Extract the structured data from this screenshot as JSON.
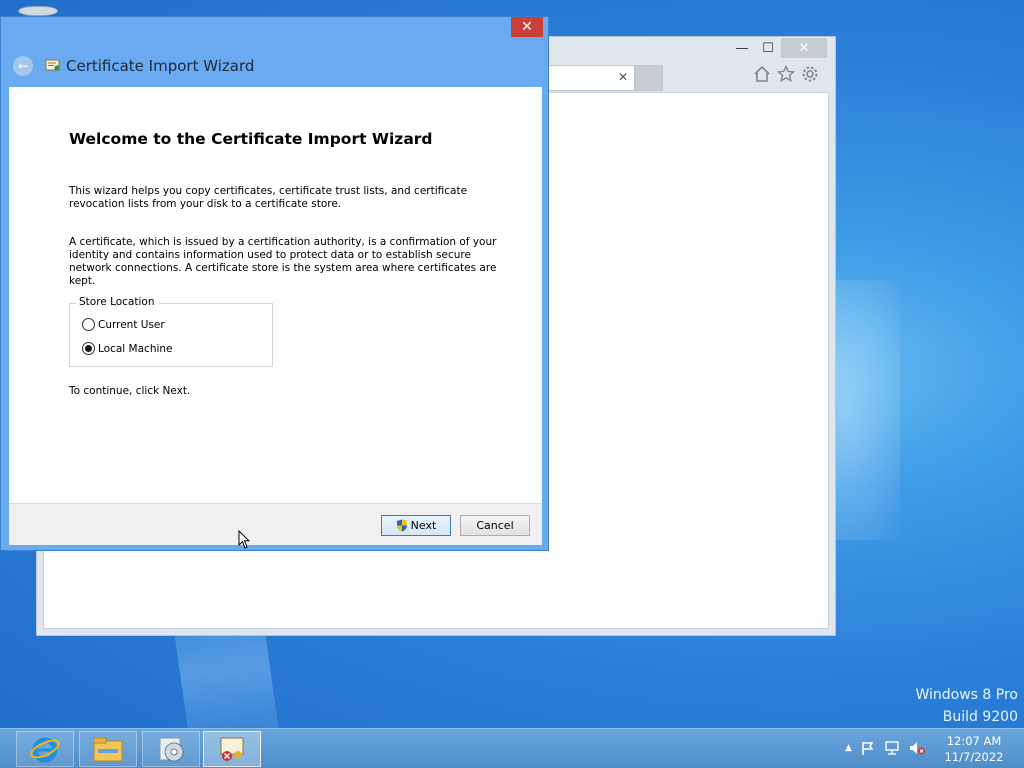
{
  "wizard": {
    "title": "Certificate Import Wizard",
    "close_glyph": "✕",
    "back_glyph": "←",
    "heading": "Welcome to the Certificate Import Wizard",
    "paragraph_1": "This wizard helps you copy certificates, certificate trust lists, and certificate revocation lists from your disk to a certificate store.",
    "paragraph_2": "A certificate, which is issued by a certification authority, is a confirmation of your identity and contains information used to protect data or to establish secure network connections. A certificate store is the system area where certificates are kept.",
    "store_location": {
      "legend": "Store Location",
      "options": [
        {
          "label": "Current User",
          "selected": false
        },
        {
          "label": "Local Machine",
          "selected": true
        }
      ]
    },
    "continue_text": "To continue, click Next.",
    "buttons": {
      "next": "Next",
      "cancel": "Cancel"
    }
  },
  "ie_window": {
    "minimize_glyph": "—",
    "maximize_glyph": "☐",
    "close_glyph": "✕",
    "tab_close_glyph": "✕",
    "tools": [
      "home-icon",
      "favorites-star-icon",
      "settings-gear-icon"
    ]
  },
  "watermark": {
    "line1": "Windows 8 Pro",
    "line2": "Build 9200"
  },
  "taskbar": {
    "items": [
      "internet-explorer-icon",
      "file-explorer-icon",
      "media-center-icon",
      "certificate-wizard-icon"
    ],
    "tray": {
      "arrow": "▲",
      "clock_time": "12:07 AM",
      "clock_date": "11/7/2022"
    }
  },
  "colors": {
    "accent": "#6aaaf0",
    "close_red": "#c9403a",
    "desktop": "#2a7fd8"
  }
}
